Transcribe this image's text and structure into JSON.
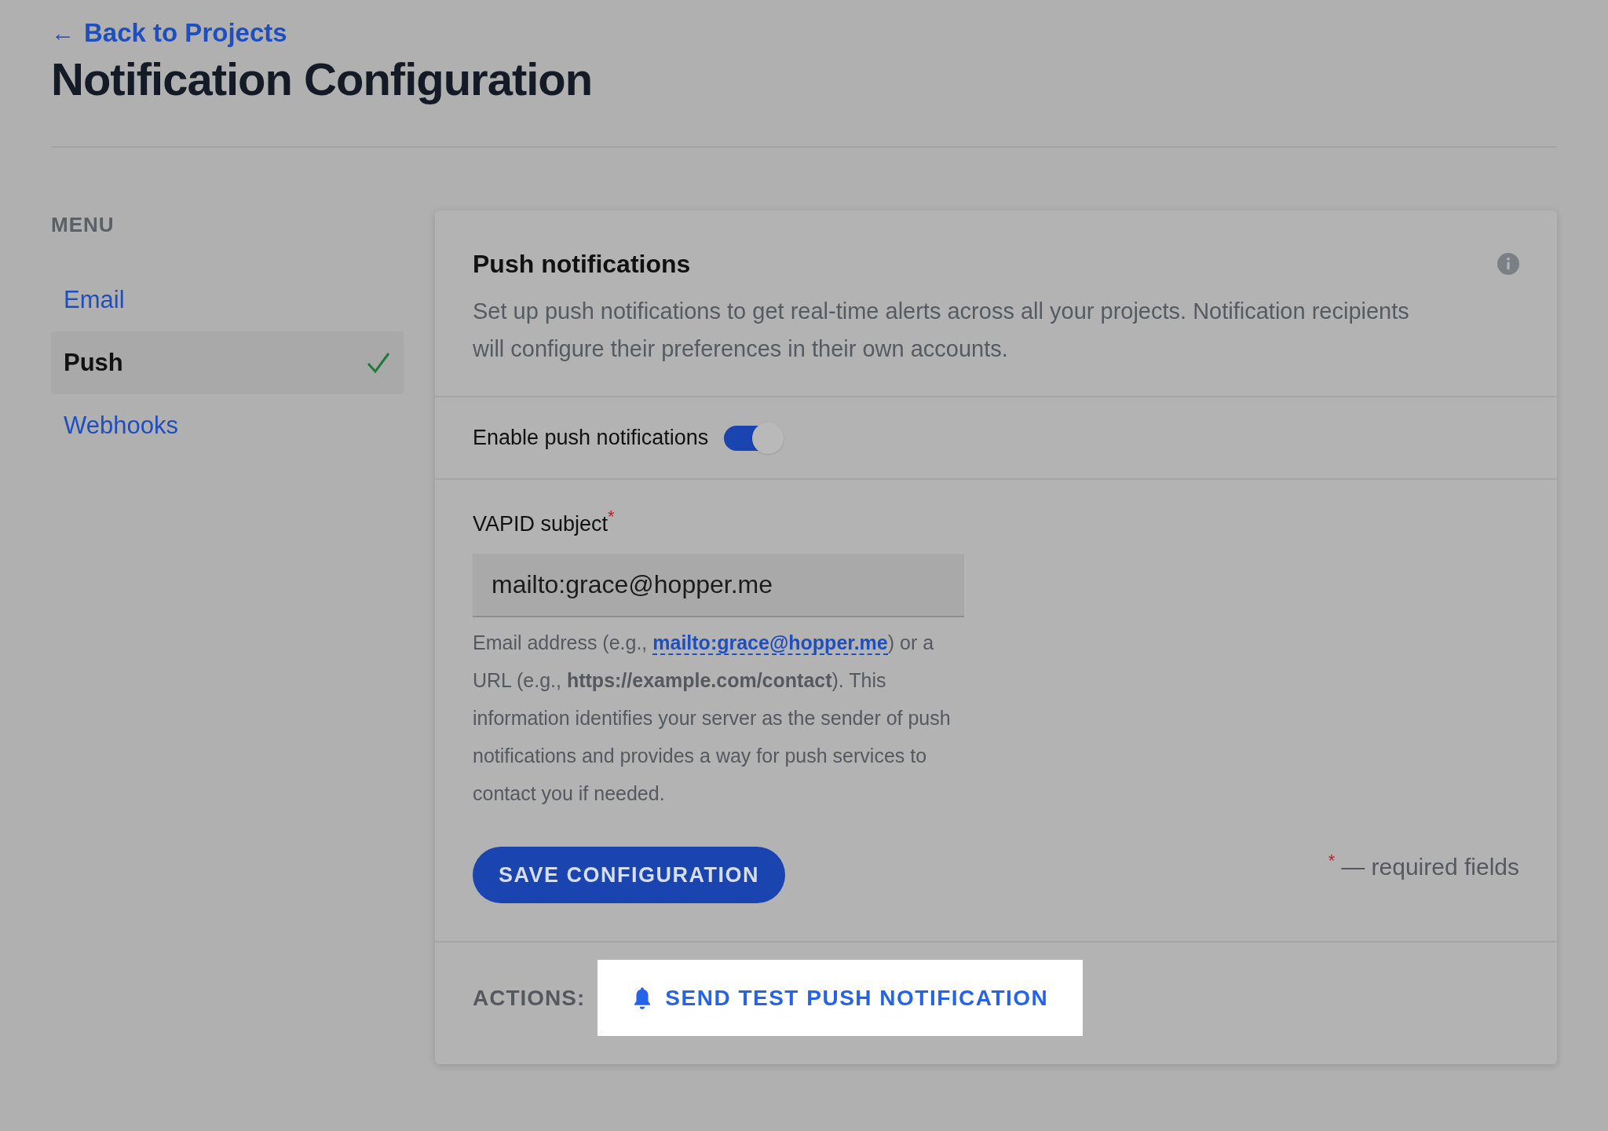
{
  "back_link": {
    "arrow": "←",
    "label": "Back to Projects"
  },
  "title": "Notification Configuration",
  "menu": {
    "heading": "MENU",
    "items": [
      {
        "label": "Email",
        "selected": false
      },
      {
        "label": "Push",
        "selected": true
      },
      {
        "label": "Webhooks",
        "selected": false
      }
    ]
  },
  "panel": {
    "heading": "Push notifications",
    "description": "Set up push notifications to get real-time alerts across all your projects. Notification recipients will configure their preferences in their own accounts.",
    "toggle": {
      "label": "Enable push notifications",
      "on": true
    },
    "field": {
      "label": "VAPID subject",
      "required_mark": "*",
      "value": "mailto:grace@hopper.me",
      "help_before": "Email address (e.g., ",
      "help_link": "mailto:grace@hopper.me",
      "help_after": ") or a URL (e.g., **https://example.com/contact**). This information identifies your server as the sender of push notifications and provides a way for push services to contact you if needed."
    },
    "save_button": "SAVE CONFIGURATION",
    "required_note": {
      "mark": "*",
      "text": "— required fields"
    },
    "actions_label": "ACTIONS:",
    "action_button": "SEND TEST PUSH NOTIFICATION"
  }
}
